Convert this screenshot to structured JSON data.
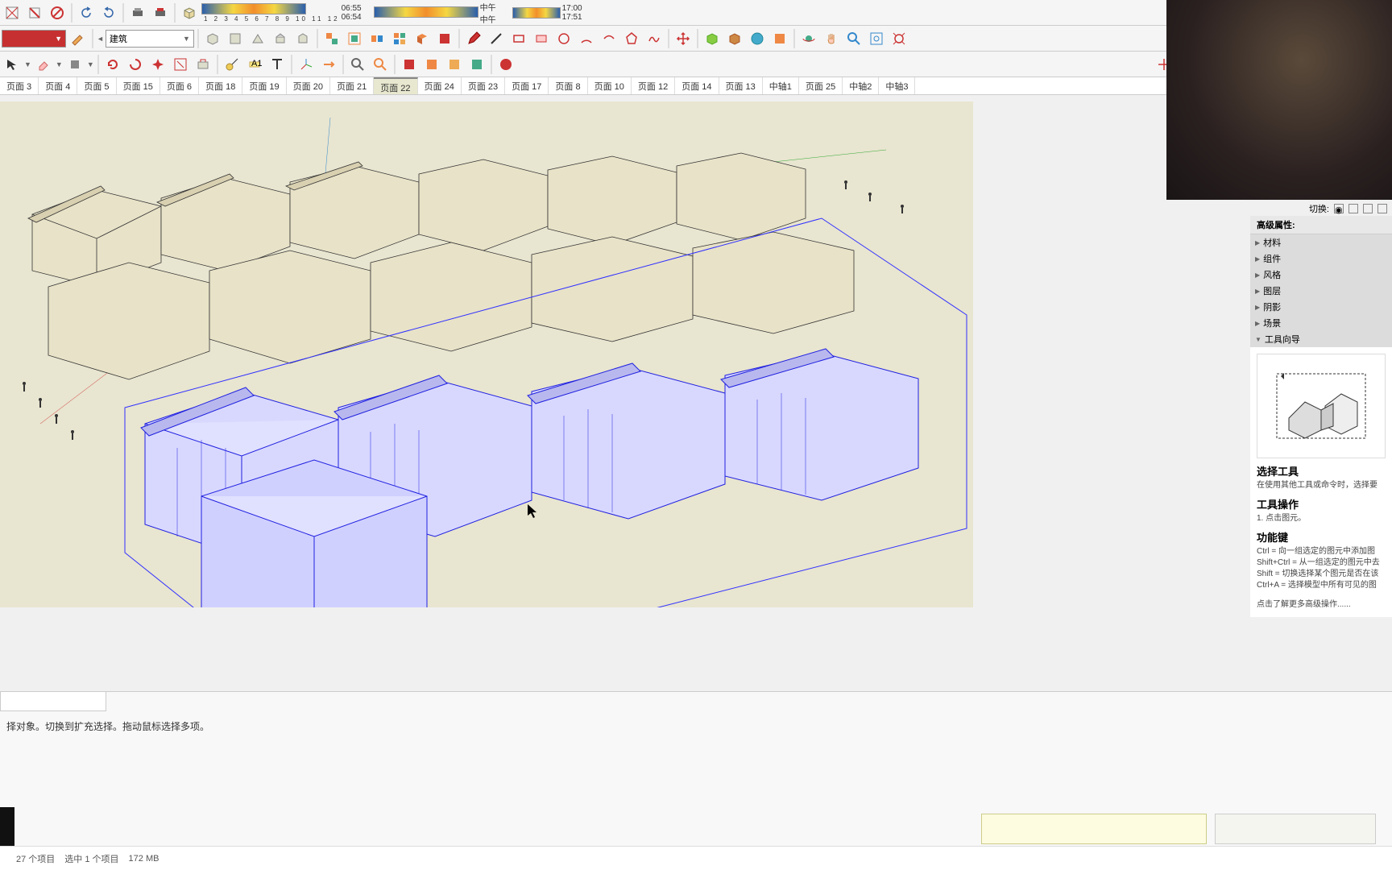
{
  "toolbar": {
    "time1": "06:55",
    "time2": "06:54",
    "noon": "中午",
    "time3": "17:00",
    "time4": "17:51",
    "ticks": "1 2 3 4 5 6 7 8 9 10 11 12"
  },
  "layer_dropdown": "建筑",
  "scene_tabs": [
    {
      "label": "页面 3",
      "active": false
    },
    {
      "label": "页面 4",
      "active": false
    },
    {
      "label": "页面 5",
      "active": false
    },
    {
      "label": "页面 15",
      "active": false
    },
    {
      "label": "页面 6",
      "active": false
    },
    {
      "label": "页面 18",
      "active": false
    },
    {
      "label": "页面 19",
      "active": false
    },
    {
      "label": "页面 20",
      "active": false
    },
    {
      "label": "页面 21",
      "active": false
    },
    {
      "label": "页面 22",
      "active": true
    },
    {
      "label": "页面 24",
      "active": false
    },
    {
      "label": "页面 23",
      "active": false
    },
    {
      "label": "页面 17",
      "active": false
    },
    {
      "label": "页面 8",
      "active": false
    },
    {
      "label": "页面 10",
      "active": false
    },
    {
      "label": "页面 12",
      "active": false
    },
    {
      "label": "页面 14",
      "active": false
    },
    {
      "label": "页面 13",
      "active": false
    },
    {
      "label": "中轴1",
      "active": false
    },
    {
      "label": "页面 25",
      "active": false
    },
    {
      "label": "中轴2",
      "active": false
    },
    {
      "label": "中轴3",
      "active": false
    }
  ],
  "switch_label": "切换:",
  "panel": {
    "adv_title": "高级属性:",
    "sections": [
      "材料",
      "组件",
      "风格",
      "图层",
      "阴影",
      "场景",
      "工具向导"
    ],
    "instructor": {
      "title": "选择工具",
      "subtitle": "在使用其他工具或命令时，选择要",
      "op_title": "工具操作",
      "op_1": "1. 点击图元。",
      "fn_title": "功能键",
      "fn_1": "Ctrl = 向一组选定的图元中添加图",
      "fn_2": "Shift+Ctrl = 从一组选定的图元中去",
      "fn_3": "Shift = 切换选择某个图元是否在该",
      "fn_4": "Ctrl+A = 选择模型中所有可见的图",
      "more": "点击了解更多高级操作......"
    }
  },
  "status_hint": "择对象。切换到扩充选择。拖动鼠标选择多项。",
  "bottom": {
    "items": "27 个项目",
    "selected": "选中 1 个项目",
    "memory": "172 MB"
  }
}
